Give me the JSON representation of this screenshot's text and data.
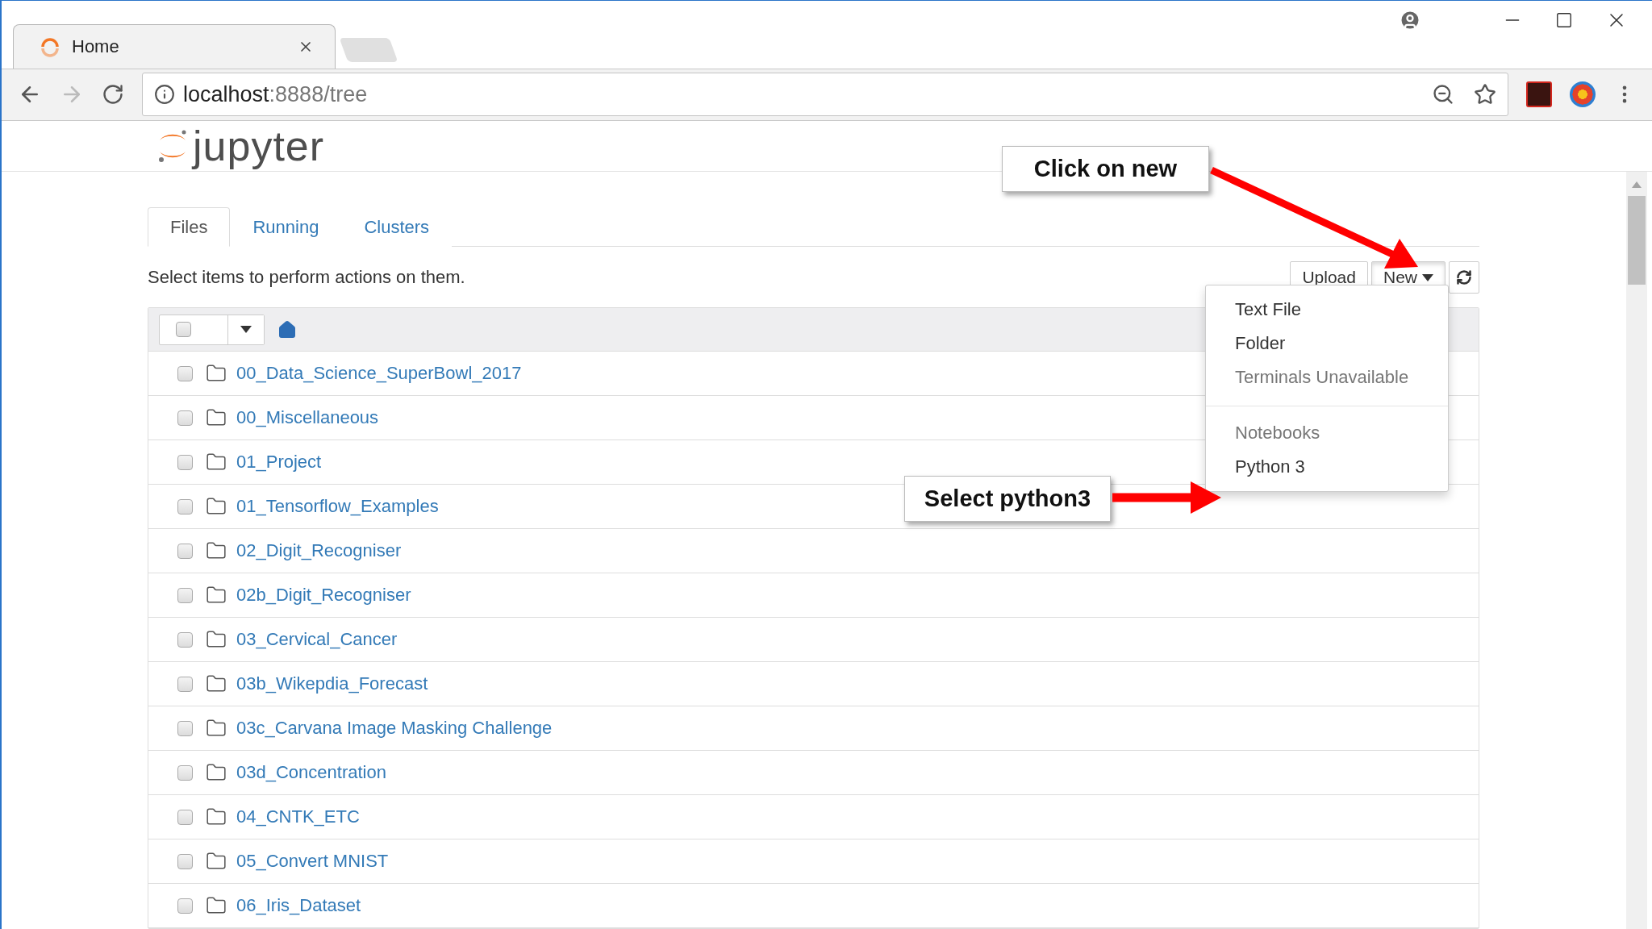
{
  "browser": {
    "tabs": [
      {
        "title": "Home",
        "selected": true
      }
    ],
    "url": {
      "host": "localhost",
      "path": ":8888/tree"
    }
  },
  "header": {
    "logo": "jupyter"
  },
  "tabs": [
    {
      "label": "Files",
      "selected": true
    },
    {
      "label": "Running",
      "selected": false
    },
    {
      "label": "Clusters",
      "selected": false
    }
  ],
  "hint": "Select items to perform actions on them.",
  "select_all": {
    "checked": false
  },
  "buttons": {
    "upload": "Upload",
    "new": {
      "label": "New",
      "expanded": true
    }
  },
  "menu": [
    {
      "kind": "item",
      "label": "Text File"
    },
    {
      "kind": "item",
      "label": "Folder"
    },
    {
      "kind": "disabled",
      "label": "Terminals Unavailable"
    },
    {
      "kind": "divider"
    },
    {
      "kind": "header",
      "label": "Notebooks"
    },
    {
      "kind": "item",
      "label": "Python 3"
    }
  ],
  "rows": [
    {
      "name": "00_Data_Science_SuperBowl_2017",
      "checked": false
    },
    {
      "name": "00_Miscellaneous",
      "checked": false
    },
    {
      "name": "01_Project",
      "checked": false
    },
    {
      "name": "01_Tensorflow_Examples",
      "checked": false
    },
    {
      "name": "02_Digit_Recogniser",
      "checked": false
    },
    {
      "name": "02b_Digit_Recogniser",
      "checked": false
    },
    {
      "name": "03_Cervical_Cancer",
      "checked": false
    },
    {
      "name": "03b_Wikepdia_Forecast",
      "checked": false
    },
    {
      "name": "03c_Carvana Image Masking Challenge",
      "checked": false
    },
    {
      "name": "03d_Concentration",
      "checked": false
    },
    {
      "name": "04_CNTK_ETC",
      "checked": false
    },
    {
      "name": "05_Convert MNIST",
      "checked": false
    },
    {
      "name": "06_Iris_Dataset",
      "checked": false
    }
  ],
  "callouts": [
    {
      "text": "Click on new"
    },
    {
      "text": "Select python3"
    }
  ]
}
